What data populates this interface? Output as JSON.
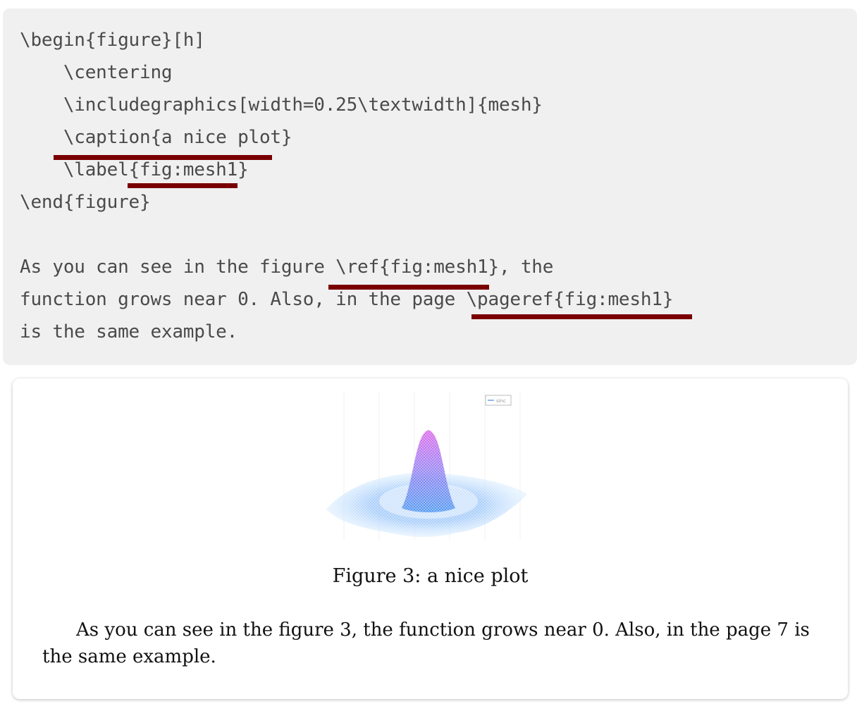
{
  "code": {
    "lines": [
      "\\begin{figure}[h]",
      "    \\centering",
      "    \\includegraphics[width=0.25\\textwidth]{mesh}",
      "    \\caption{a nice plot}",
      "    \\label{fig:mesh1}",
      "\\end{figure}",
      "",
      "As you can see in the figure \\ref{fig:mesh1}, the",
      "function grows near 0. Also, in the page \\pageref{fig:mesh1}",
      "is the same example."
    ],
    "highlight_color": "#7a0000"
  },
  "rendered": {
    "caption": "Figure 3: a nice plot",
    "paragraph": "As you can see in the figure 3, the function grows near 0. Also, in the page 7 is the same example.",
    "figure_legend_label": "sinc"
  }
}
